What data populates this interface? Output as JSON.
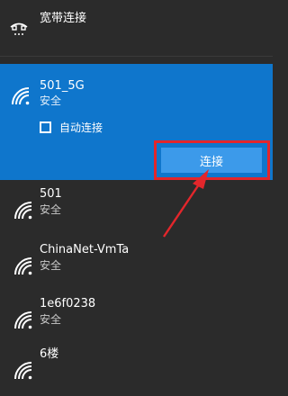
{
  "dial_up": {
    "icon": "dialup-icon",
    "label": "宽带连接"
  },
  "selected_network": {
    "name": "501_5G",
    "status": "安全",
    "icon": "wifi-signal-icon",
    "auto_connect": {
      "label": "自动连接",
      "checked": false
    },
    "connect_label": "连接"
  },
  "networks": [
    {
      "name": "501",
      "status": "安全",
      "icon": "wifi-signal-icon"
    },
    {
      "name": "ChinaNet-VmTa",
      "status": "安全",
      "icon": "wifi-signal-icon"
    },
    {
      "name": "1e6f0238",
      "status": "安全",
      "icon": "wifi-signal-icon"
    },
    {
      "name": "6楼",
      "status": "",
      "icon": "wifi-signal-icon"
    }
  ],
  "colors": {
    "panel_bg": "#2b2b2b",
    "selected_bg": "#0f76cc",
    "button_bg": "#3c9aea",
    "highlight": "#e3262b"
  }
}
